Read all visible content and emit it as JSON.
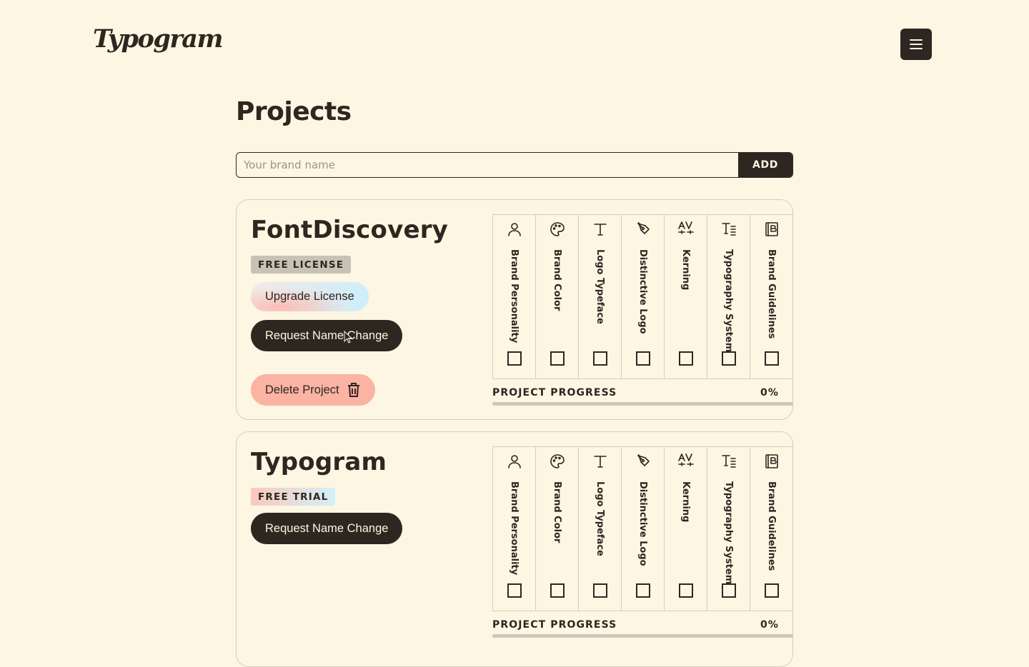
{
  "header": {
    "logo_text": "Typogram",
    "menu_icon": "hamburger-menu-icon"
  },
  "page": {
    "title": "Projects"
  },
  "add_form": {
    "placeholder": "Your brand name",
    "value": "",
    "add_label": "ADD"
  },
  "step_labels": [
    "Brand Personality",
    "Brand Color",
    "Logo Typeface",
    "Distinctive Logo",
    "Kerning",
    "Typography System",
    "Brand Guidelines"
  ],
  "step_icons": [
    "user-icon",
    "palette-icon",
    "type-icon",
    "pen-tool-icon",
    "kerning-icon",
    "typography-icon",
    "guidelines-book-icon"
  ],
  "projects": [
    {
      "name": "FontDiscovery",
      "badge": "FREE LICENSE",
      "upgrade_label": "Upgrade License",
      "request_label": "Request Name Change",
      "delete_label": "Delete Project",
      "progress_label": "PROJECT PROGRESS",
      "progress_value": "0%",
      "progress": 0,
      "checked": [
        false,
        false,
        false,
        false,
        false,
        false,
        false
      ]
    },
    {
      "name": "Typogram",
      "badge": "FREE TRIAL",
      "request_label": "Request Name Change",
      "progress_label": "PROJECT PROGRESS",
      "progress_value": "0%",
      "progress": 0,
      "checked": [
        false,
        false,
        false,
        false,
        false,
        false,
        false
      ]
    }
  ],
  "colors": {
    "background": "#fdf6e2",
    "ink": "#2e2620",
    "delete": "#fbb3a4",
    "border": "#d6cdbf"
  }
}
